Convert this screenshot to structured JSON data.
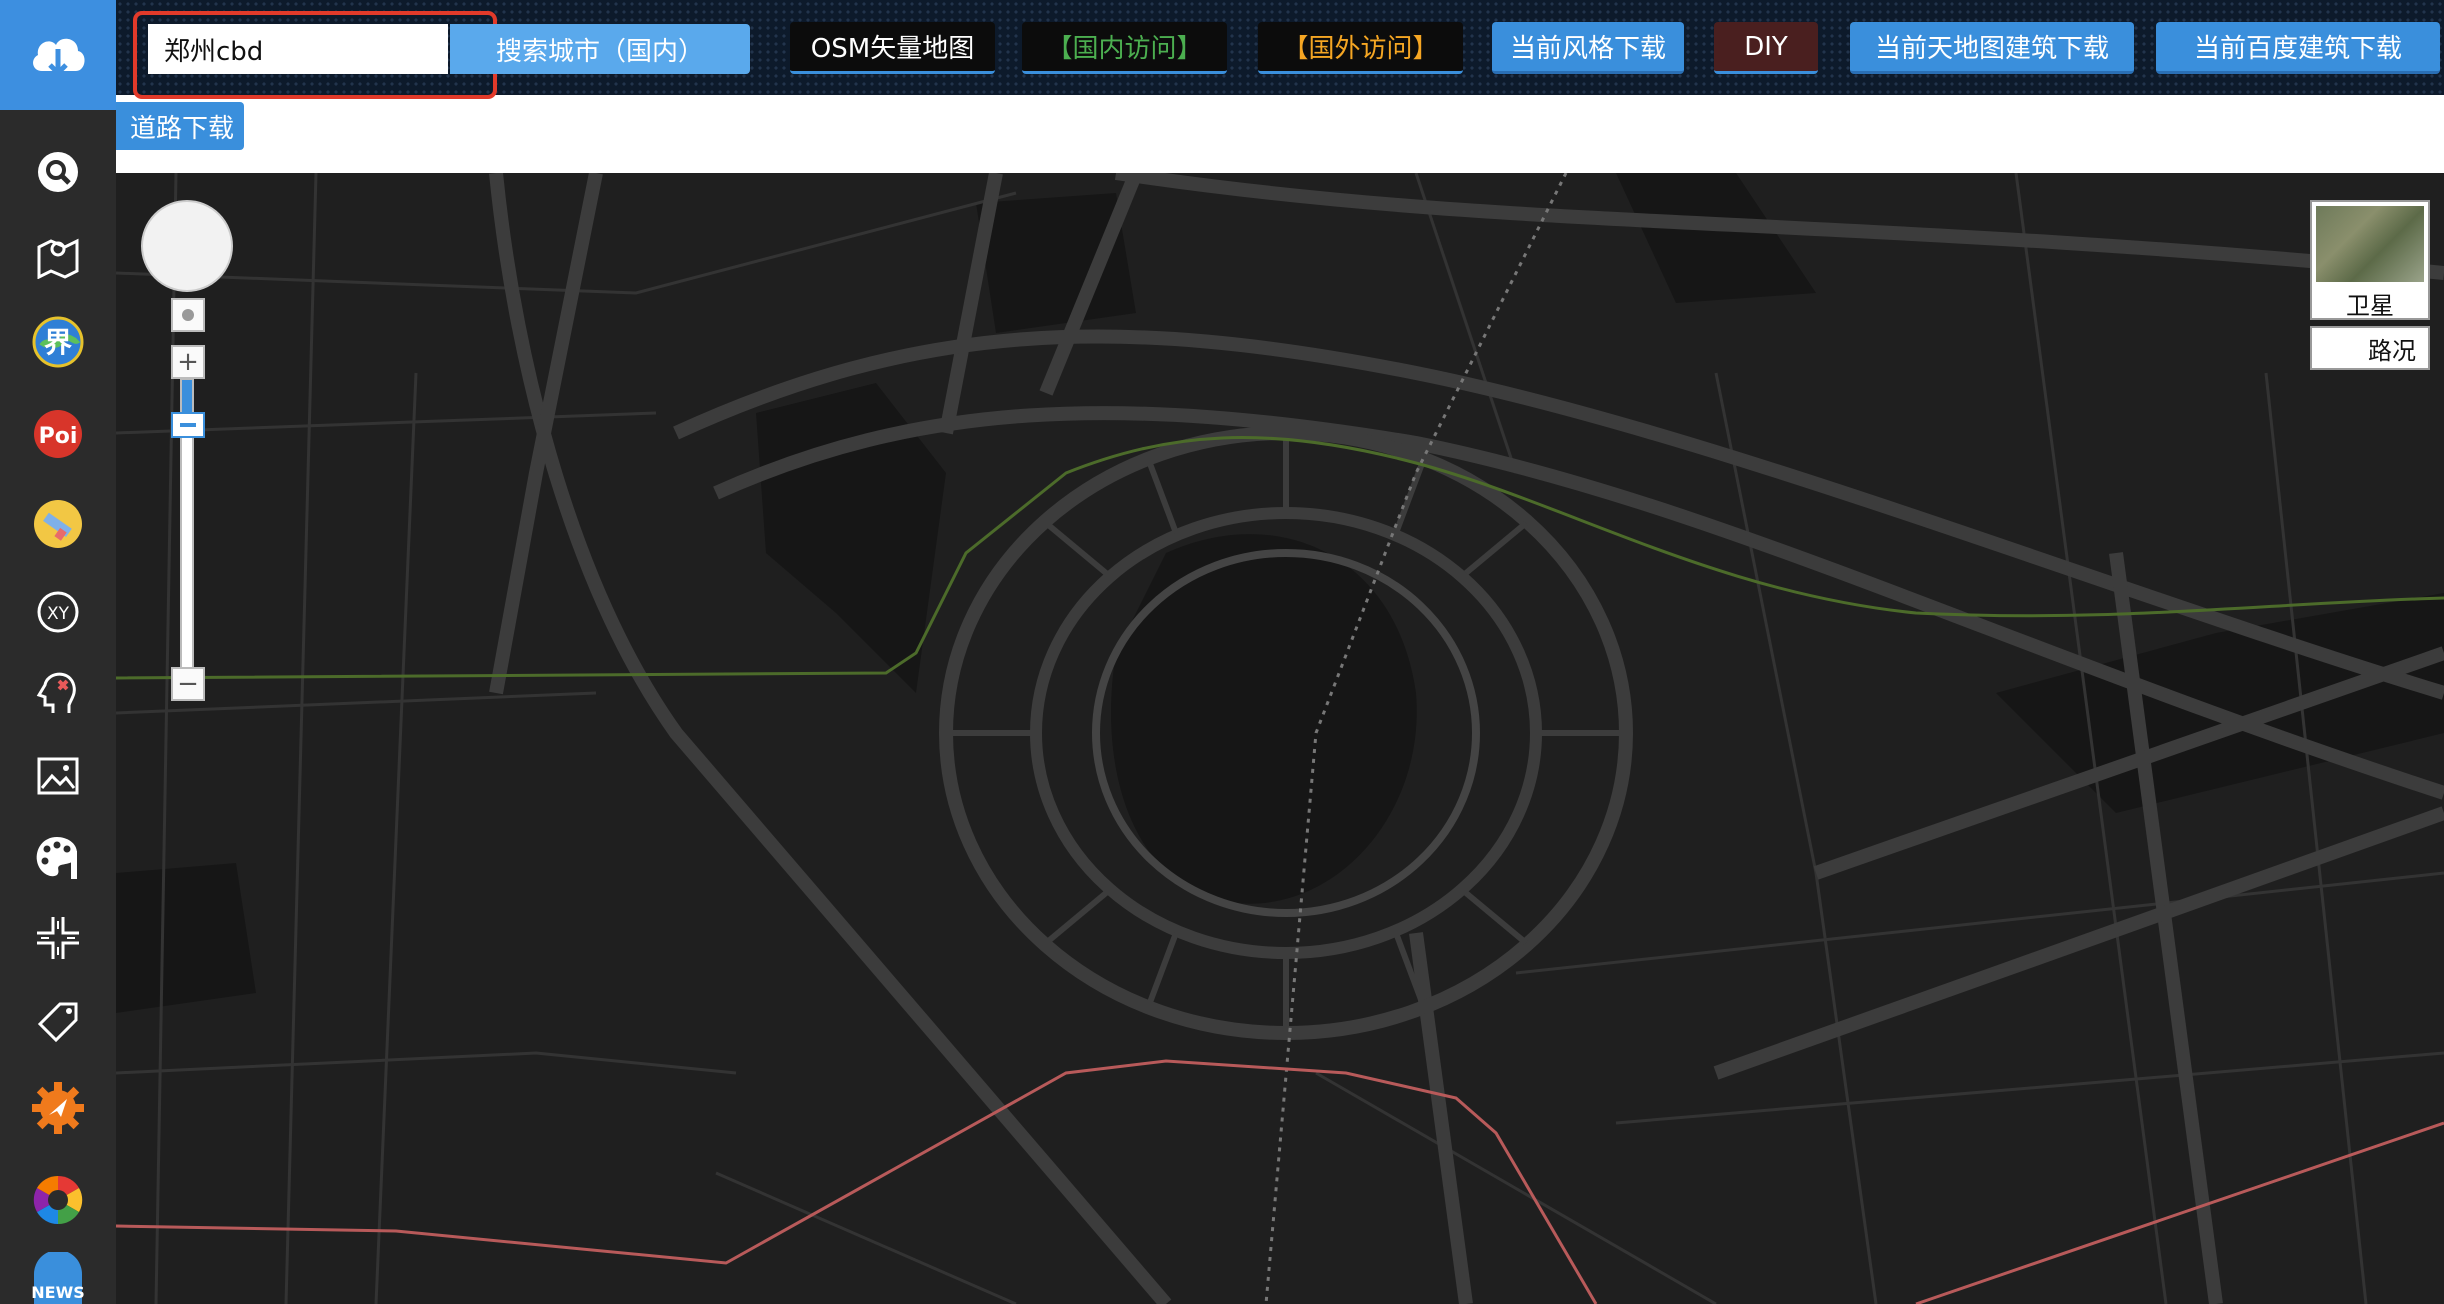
{
  "sidebar": {
    "logo_icon": "cloud-download-icon",
    "items": [
      {
        "name": "search-icon"
      },
      {
        "name": "map-pin-icon"
      },
      {
        "name": "boundary-globe-icon",
        "label": "界"
      },
      {
        "name": "poi-icon",
        "label": "Poi"
      },
      {
        "name": "pencil-draw-icon"
      },
      {
        "name": "xy-coordinate-icon",
        "label": "XY"
      },
      {
        "name": "head-settings-icon"
      },
      {
        "name": "image-icon"
      },
      {
        "name": "palette-icon"
      },
      {
        "name": "road-junction-icon"
      },
      {
        "name": "tag-icon"
      },
      {
        "name": "gear-icon"
      },
      {
        "name": "color-wheel-icon"
      },
      {
        "name": "news-icon",
        "label": "NEWS"
      }
    ]
  },
  "search": {
    "value": "郑州cbd",
    "button_label": "搜索城市（国内）"
  },
  "toolbar": {
    "osm_label": "OSM矢量地图",
    "domestic_label": "【国内访问】",
    "foreign_label": "【国外访问】",
    "style_download_label": "当前风格下载",
    "diy_label": "DIY",
    "tianditu_label": "当前天地图建筑下载",
    "baidu_label": "当前百度建筑下载",
    "road_download_label": "道路下载"
  },
  "map": {
    "background_color": "#1f1f1f",
    "road_color": "#3c3c3c",
    "green_route_color": "#4c6b2a",
    "red_route_color": "#b85a5a",
    "controls": {
      "zoom_in": "+",
      "zoom_out": "−",
      "zoom_level_fraction": 0.15
    },
    "maptype": {
      "satellite_label": "卫星",
      "traffic_label": "路况"
    }
  },
  "colors": {
    "accent": "#3a8fdc",
    "highlight_border": "#e23a2a",
    "domestic": "#4caf50",
    "foreign": "#f5a623"
  }
}
